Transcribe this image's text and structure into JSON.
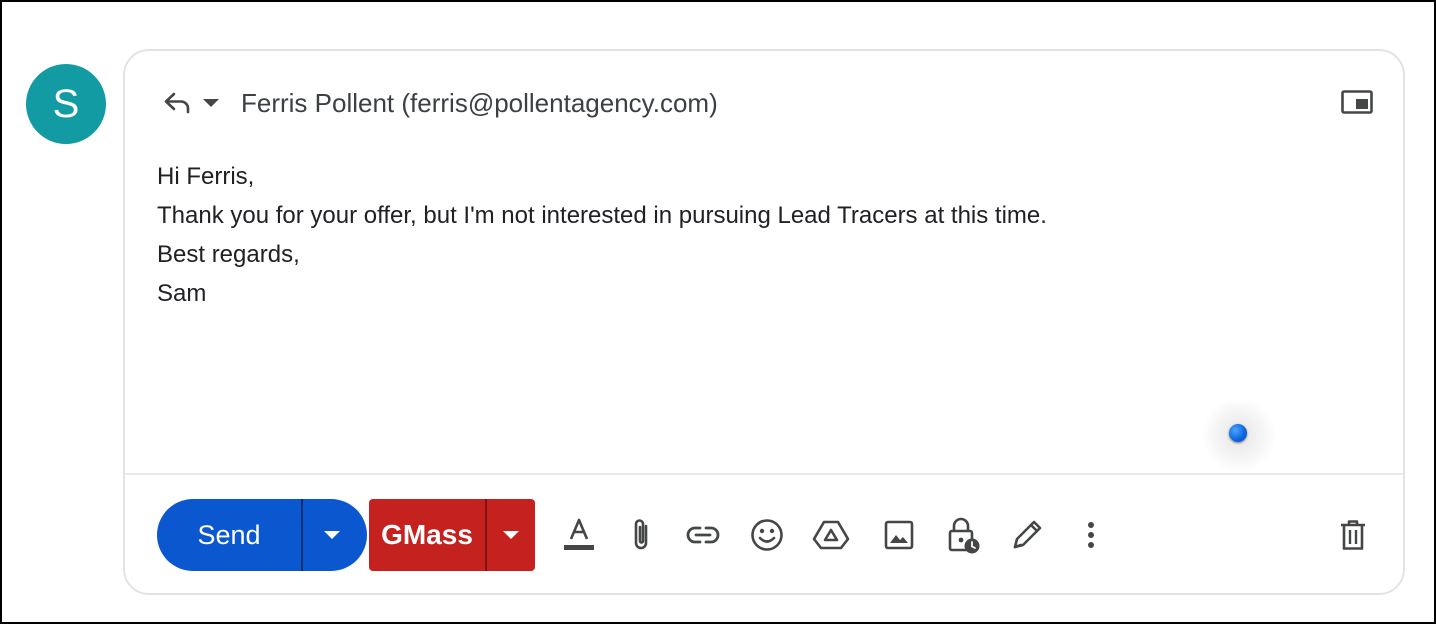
{
  "avatar": {
    "initial": "S",
    "color": "#129ba3"
  },
  "header": {
    "reply_icon": "reply-icon",
    "reply_menu_icon": "chevron-down-icon",
    "recipient": "Ferris Pollent (ferris@pollentagency.com)",
    "popout_icon": "popout-icon"
  },
  "message": {
    "lines": [
      "Hi Ferris,",
      "Thank you for your offer, but I'm not interested in pursuing Lead Tracers at this time.",
      "Best regards,",
      "Sam"
    ]
  },
  "toolbar": {
    "send_label": "Send",
    "send_color": "#0b57d0",
    "gmass_label": "GMass",
    "gmass_color": "#c5221f",
    "tools": [
      "text-format-icon",
      "attach-icon",
      "link-icon",
      "emoji-icon",
      "drive-icon",
      "image-icon",
      "confidential-mode-icon",
      "signature-icon",
      "more-options-icon"
    ],
    "discard_icon": "trash-icon"
  }
}
